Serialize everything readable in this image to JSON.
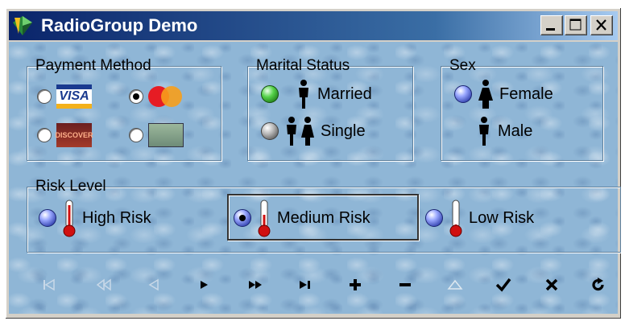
{
  "window": {
    "title": "RadioGroup Demo"
  },
  "payment": {
    "legend": "Payment Method",
    "options": [
      {
        "icon": "visa-card-icon",
        "text": "VISA",
        "selected": false
      },
      {
        "icon": "mastercard-icon",
        "text": "MasterCard",
        "selected": true
      },
      {
        "icon": "discover-card-icon",
        "text": "DISCOVER",
        "selected": false
      },
      {
        "icon": "amex-card-icon",
        "text": "",
        "selected": false
      }
    ]
  },
  "marital": {
    "legend": "Marital Status",
    "options": [
      {
        "label": "Married",
        "selected": false
      },
      {
        "label": "Single",
        "selected": false
      }
    ]
  },
  "sex": {
    "legend": "Sex",
    "options": [
      {
        "label": "Female",
        "selected": false
      },
      {
        "label": "Male",
        "selected": false
      }
    ]
  },
  "risk": {
    "legend": "Risk Level",
    "options": [
      {
        "label": "High Risk",
        "selected": false
      },
      {
        "label": "Medium Risk",
        "selected": true
      },
      {
        "label": "Low Risk",
        "selected": false
      }
    ]
  },
  "navigator": {
    "buttons": [
      "first",
      "prior-page",
      "prior",
      "next",
      "next-page",
      "last",
      "insert",
      "delete",
      "edit",
      "post",
      "cancel",
      "refresh"
    ]
  },
  "colors": {
    "title_gradient_start": "#0a246a",
    "title_gradient_end": "#a6caf0",
    "client_bg": "#8fb6d6"
  }
}
